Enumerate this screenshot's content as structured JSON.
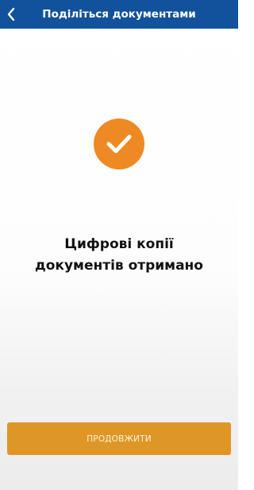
{
  "header": {
    "title": "Поділіться документами",
    "back_icon": "chevron-left-icon",
    "background_color": "#12529c"
  },
  "status": {
    "icon": "checkmark-icon",
    "circle_color": "#ee8a23",
    "message_line1": "Цифрові копії",
    "message_line2": "документів отримано"
  },
  "footer": {
    "continue_label": "ПРОДОВЖИТИ",
    "button_color": "#de9727"
  }
}
